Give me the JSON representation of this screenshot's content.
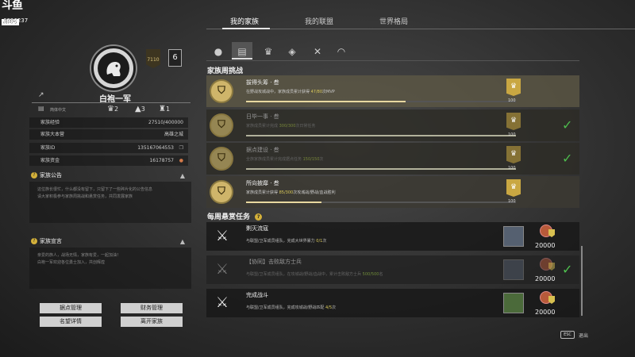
{
  "watermark": {
    "logo": "斗鱼",
    "tag": "房间号",
    "room_id": "6096237"
  },
  "tabs": [
    {
      "label": "我的家族",
      "active": true
    },
    {
      "label": "我的联盟",
      "active": false
    },
    {
      "label": "世界格局",
      "active": false
    }
  ],
  "family": {
    "name": "白袍一军",
    "emblem_icon": "lion-emblem-icon",
    "rank": "7110",
    "level": "6",
    "language": "简体中文",
    "stats": {
      "members_a": "2",
      "members_b": "3",
      "members_c": "1"
    },
    "info": [
      {
        "label": "家族经验",
        "value": "27510/400000"
      },
      {
        "label": "家族大本营",
        "value": "高雄之城"
      },
      {
        "label": "家族ID",
        "value": "135167064553"
      },
      {
        "label": "家族资金",
        "value": "16178757"
      }
    ],
    "notice": {
      "title": "家族公告",
      "text_line1": "这位族长很忙，什么都没有留下，只留下了一些碎片化的公告信息",
      "text_line2": "请大家积极参与家族周挑战和悬赏任务，共同发展家族"
    },
    "declaration": {
      "title": "家族宣言",
      "text_line1": "亲爱的族人，战场无情，家族有爱，一起加油！",
      "text_line2": "白袍一军欢迎各位勇士加入，共创辉煌"
    },
    "buttons": [
      "据点管理",
      "财务管理",
      "名望详情",
      "离开家族"
    ]
  },
  "weekly": {
    "title": "家族周挑战",
    "challenges": [
      {
        "title": "拔得头筹 · 叁",
        "desc": "在野战攻城战中，家族成员累计获得",
        "progress": "47/80",
        "desc_suffix": "次MVP",
        "reward": "100",
        "done": false,
        "fill": 0.59
      },
      {
        "title": "日毕一事 · 叁",
        "desc": "家族成员累计完成",
        "progress": "300/300",
        "desc_suffix": "次日常任务",
        "reward": "100",
        "done": true,
        "fill": 1.0
      },
      {
        "title": "据点建设 · 叁",
        "desc": "全族家族成员累计完成据点任务",
        "progress": "150/150",
        "desc_suffix": "次",
        "reward": "100",
        "done": true,
        "fill": 1.0
      },
      {
        "title": "所向披靡 · 叁",
        "desc": "家族成员累计获得",
        "progress": "85/300",
        "desc_suffix": "次攻城战/野战/血战胜利",
        "reward": "100",
        "done": false,
        "fill": 0.28
      }
    ]
  },
  "bounty": {
    "title": "每周悬赏任务",
    "tasks": [
      {
        "title": "剿灭流寇",
        "desc": "与联盟/卫军成员组队，完成大世界暴力",
        "progress": "0/1",
        "desc_suffix": "次",
        "reward": "20000",
        "done": false
      },
      {
        "title": "【协同】击败敌方士兵",
        "desc": "与联盟/卫军成员组队，在攻城战/野战/血战中，累计击败敌方士兵",
        "progress": "500/500",
        "desc_suffix": "名",
        "reward": "20000",
        "done": true
      },
      {
        "title": "完成战斗",
        "desc": "与联盟/卫军成员组队，完成攻城战/野战匹配",
        "progress": "4/5",
        "desc_suffix": "次",
        "reward": "20000",
        "done": false
      }
    ]
  },
  "esc": {
    "key": "ESC",
    "label": "退出"
  }
}
